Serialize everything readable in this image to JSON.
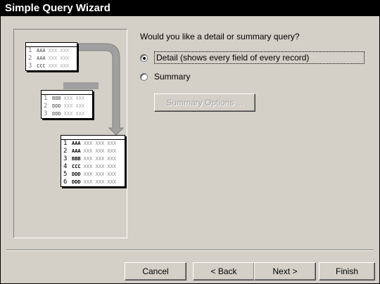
{
  "window": {
    "title": "Simple Query Wizard"
  },
  "question": "Would you like a detail or summary query?",
  "options": {
    "detail": {
      "label": "Detail (shows every field of every record)",
      "selected": true
    },
    "summary": {
      "label": "Summary",
      "selected": false
    }
  },
  "summary_options_button": "Summary Options ...",
  "buttons": {
    "cancel": "Cancel",
    "back": "< Back",
    "next": "Next >",
    "finish": "Finish"
  },
  "illustration": {
    "source_table": [
      {
        "n": "1",
        "k": "AAA",
        "x": "XXX XXX"
      },
      {
        "n": "2",
        "k": "AAA",
        "x": "XXX XXX"
      },
      {
        "n": "3",
        "k": "CCC",
        "x": "XXX XXX"
      }
    ],
    "second_table": [
      {
        "n": "1",
        "k": "BBB",
        "x": "XXX XXX"
      },
      {
        "n": "2",
        "k": "DDD",
        "x": "XXX XXX"
      },
      {
        "n": "3",
        "k": "DDD",
        "x": "XXX XXX"
      }
    ],
    "result_table": [
      {
        "n": "1",
        "k": "AAA",
        "x": "XXX XXX XXX"
      },
      {
        "n": "2",
        "k": "AAA",
        "x": "XXX XXX XXX"
      },
      {
        "n": "3",
        "k": "BBB",
        "x": "XXX XXX XXX"
      },
      {
        "n": "4",
        "k": "CCC",
        "x": "XXX XXX XXX"
      },
      {
        "n": "5",
        "k": "DDD",
        "x": "XXX XXX XXX"
      },
      {
        "n": "6",
        "k": "DDD",
        "x": "XXX XXX XXX"
      }
    ]
  }
}
